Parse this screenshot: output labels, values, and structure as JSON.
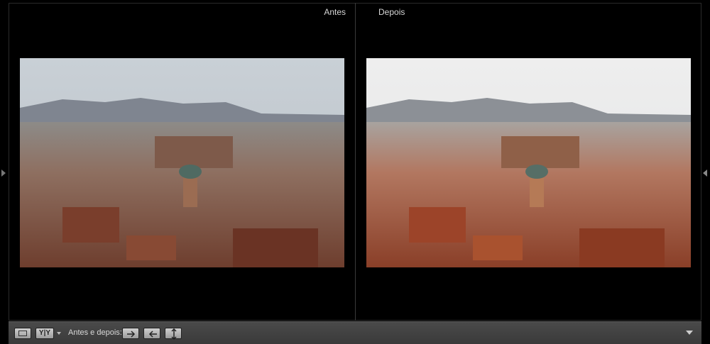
{
  "panels": {
    "before_label": "Antes",
    "after_label": "Depois"
  },
  "toolbar": {
    "view_mode_label": "Y|Y",
    "before_after_label": "Antes e depois:"
  },
  "icons": {
    "loupe": "loupe-view-icon",
    "copy_right": "arrow-right-icon",
    "copy_left": "arrow-left-icon",
    "swap": "swap-icon",
    "menu": "chevron-down-icon"
  },
  "colors": {
    "background": "#000000",
    "toolbar": "#404040",
    "label_text": "#d6d6d6"
  }
}
